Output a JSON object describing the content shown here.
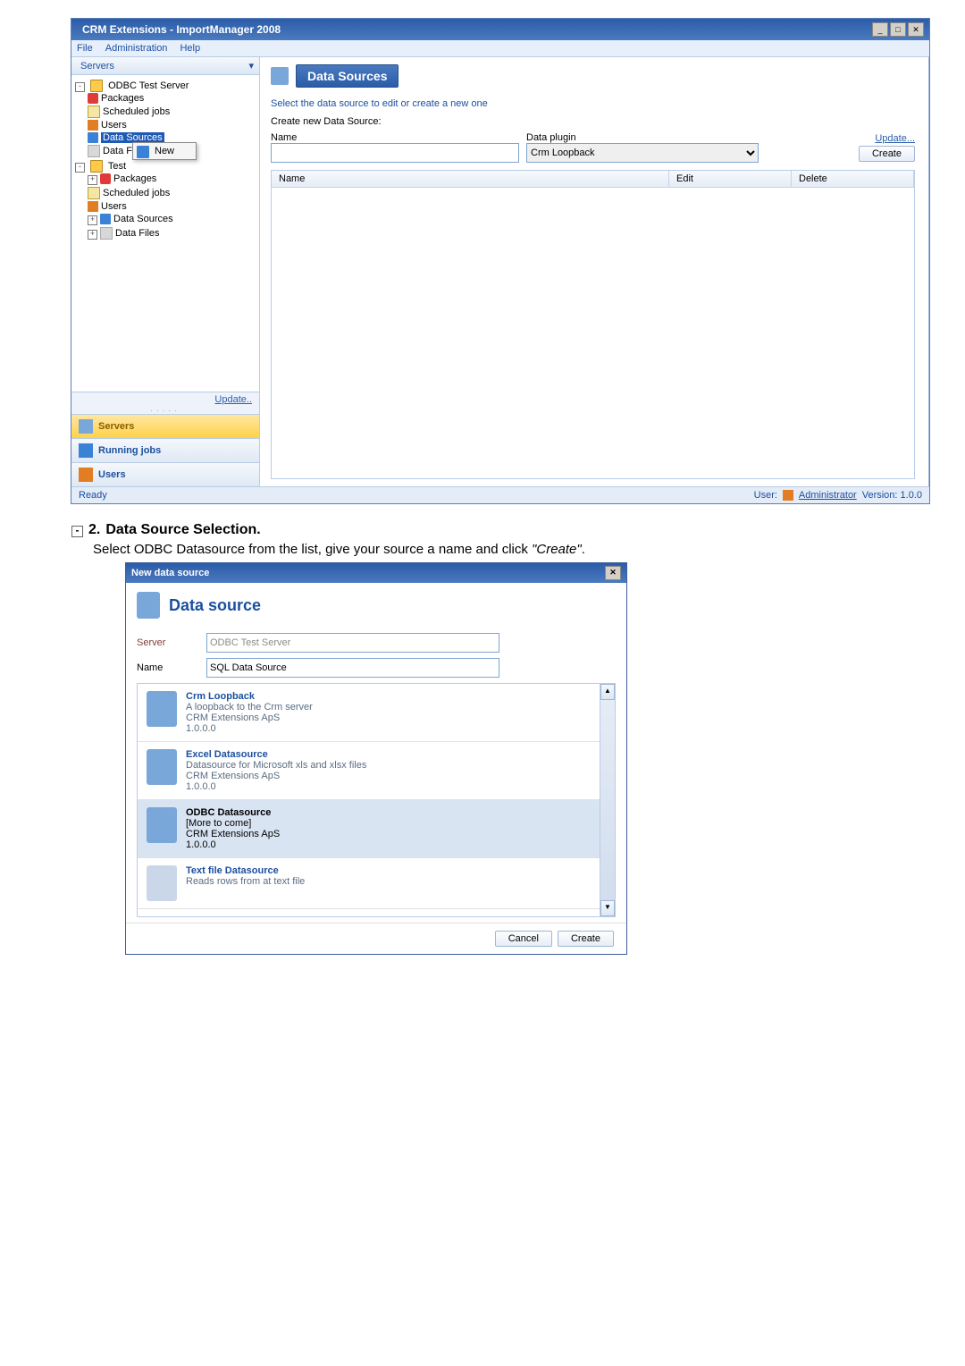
{
  "app": {
    "title": "CRM Extensions - ImportManager 2008",
    "menu": {
      "file": "File",
      "administration": "Administration",
      "help": "Help"
    }
  },
  "sidebar": {
    "header": "Servers",
    "tree": {
      "server1": "ODBC Test Server",
      "packages": "Packages",
      "scheduled": "Scheduled jobs",
      "users": "Users",
      "datasources": "Data Sources",
      "datafiles": "Data Fil",
      "context_new": "New",
      "server2": "Test",
      "packages2": "Packages",
      "scheduled2": "Scheduled jobs",
      "users2": "Users",
      "datasources2": "Data Sources",
      "datafiles2": "Data Files"
    },
    "update_link": "Update..",
    "panels": {
      "servers": "Servers",
      "running": "Running jobs",
      "users": "Users"
    }
  },
  "main": {
    "heading": "Data Sources",
    "subheading": "Select the data source to edit or create a new one",
    "create_label": "Create new Data Source:",
    "name_label": "Name",
    "plugin_label": "Data plugin",
    "name_value": "",
    "plugin_selected": "Crm Loopback",
    "update_link": "Update...",
    "create_button": "Create",
    "grid": {
      "col_name": "Name",
      "col_edit": "Edit",
      "col_delete": "Delete"
    }
  },
  "status": {
    "ready": "Ready",
    "user_prefix": "User:",
    "user_name": "Administrator",
    "version": "Version: 1.0.0"
  },
  "section2": {
    "number": "2.",
    "title": "Data Source Selection.",
    "text_a": "Select ODBC Datasource from the list, give your source a name and click ",
    "text_b": "\"Create\"",
    "text_c": "."
  },
  "dialog": {
    "title": "New data source",
    "heading": "Data source",
    "server_label": "Server",
    "server_value": "ODBC Test Server",
    "name_label": "Name",
    "name_value": "SQL Data Source",
    "items": [
      {
        "name": "Crm Loopback",
        "desc": "A loopback to the Crm server",
        "vendor": "CRM Extensions ApS",
        "ver": "1.0.0.0"
      },
      {
        "name": "Excel Datasource",
        "desc": "Datasource for Microsoft xls and xlsx files",
        "vendor": "CRM Extensions ApS",
        "ver": "1.0.0.0"
      },
      {
        "name": "ODBC Datasource",
        "desc": "[More to come]",
        "vendor": "CRM Extensions ApS",
        "ver": "1.0.0.0"
      },
      {
        "name": "Text file Datasource",
        "desc": "Reads rows from at text file",
        "vendor": "",
        "ver": ""
      }
    ],
    "cancel": "Cancel",
    "create": "Create"
  }
}
